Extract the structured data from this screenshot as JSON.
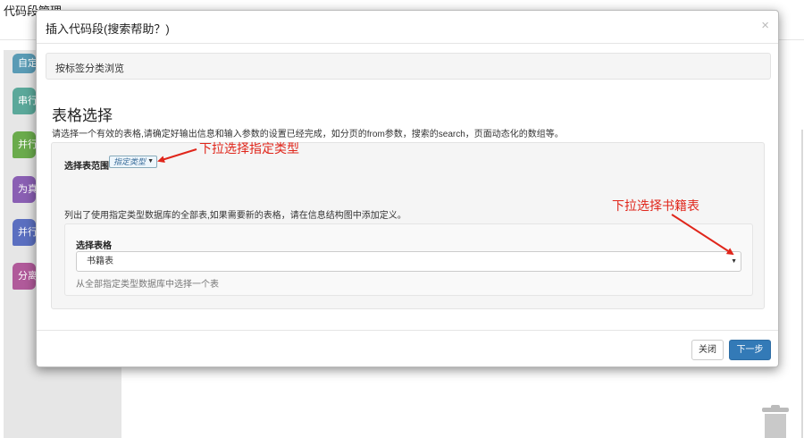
{
  "background": {
    "page_title": "代码段管理",
    "blocks": [
      {
        "label": "自定",
        "color": "#5a9bb5"
      },
      {
        "label": "串行",
        "color": "#5ba89a"
      },
      {
        "label": "并行",
        "color": "#6aab4c"
      },
      {
        "label": "为真",
        "color": "#8a5fb3"
      },
      {
        "label": "并行",
        "color": "#5b6fc0"
      },
      {
        "label": "分离",
        "color": "#b05a9a"
      }
    ]
  },
  "modal": {
    "title": "插入代码段(搜索帮助？)",
    "close_glyph": "×",
    "breadcrumb": "按标签分类浏览",
    "section_title": "表格选择",
    "section_desc": "请选择一个有效的表格,请确定好输出信息和输入参数的设置已经完成，如分页的from参数，搜索的search，页面动态化的数组等。",
    "scope_label": "选择表范围",
    "scope_value": "指定类型",
    "list_note": "列出了使用指定类型数据库的全部表,如果需要新的表格，请在信息结构图中添加定义。",
    "table_label": "选择表格",
    "table_value": "书籍表",
    "table_help": "从全部指定类型数据库中选择一个表",
    "close_button": "关闭",
    "next_button": "下一步"
  },
  "annotations": {
    "scope_hint": "下拉选择指定类型",
    "table_hint": "下拉选择书籍表",
    "color": "#e0261b"
  }
}
